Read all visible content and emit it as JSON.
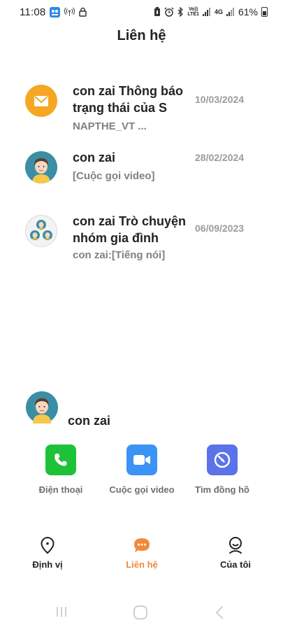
{
  "status_bar": {
    "time": "11:08",
    "battery": "61%",
    "network_4g": "4G",
    "volte_label": "Vo))",
    "lte_label": "LTE1"
  },
  "header": {
    "title": "Liên hệ"
  },
  "conversations": [
    {
      "name": "con zai Thông báo trạng thái của S",
      "date": "10/03/2024",
      "preview": "NAPTHE_VT ...",
      "avatar_icon": "envelope-icon"
    },
    {
      "name": "con zai",
      "date": "28/02/2024",
      "preview": "[Cuộc gọi video]",
      "avatar_icon": "person-avatar"
    },
    {
      "name": "con zai Trò chuyện nhóm gia đình",
      "date": "06/09/2023",
      "preview": "con zai:[Tiếng nói]",
      "avatar_icon": "group-avatar"
    }
  ],
  "contact": {
    "name": "con zai",
    "actions": [
      {
        "label": "Điện thoại",
        "icon": "phone-icon",
        "color": "#1ec238"
      },
      {
        "label": "Cuộc gọi video",
        "icon": "video-camera-icon",
        "color": "#3a93f5"
      },
      {
        "label": "Tìm đồng hồ",
        "icon": "watch-finder-icon",
        "color": "#5b72e8"
      }
    ]
  },
  "tabs": [
    {
      "label": "Định vị",
      "icon": "location-pin-icon",
      "active": false
    },
    {
      "label": "Liên hệ",
      "icon": "chat-bubble-icon",
      "active": true
    },
    {
      "label": "Của tôi",
      "icon": "profile-icon",
      "active": false
    }
  ],
  "colors": {
    "accent": "#f08a3c",
    "mail_avatar": "#f5a623",
    "text_secondary": "#808080"
  }
}
